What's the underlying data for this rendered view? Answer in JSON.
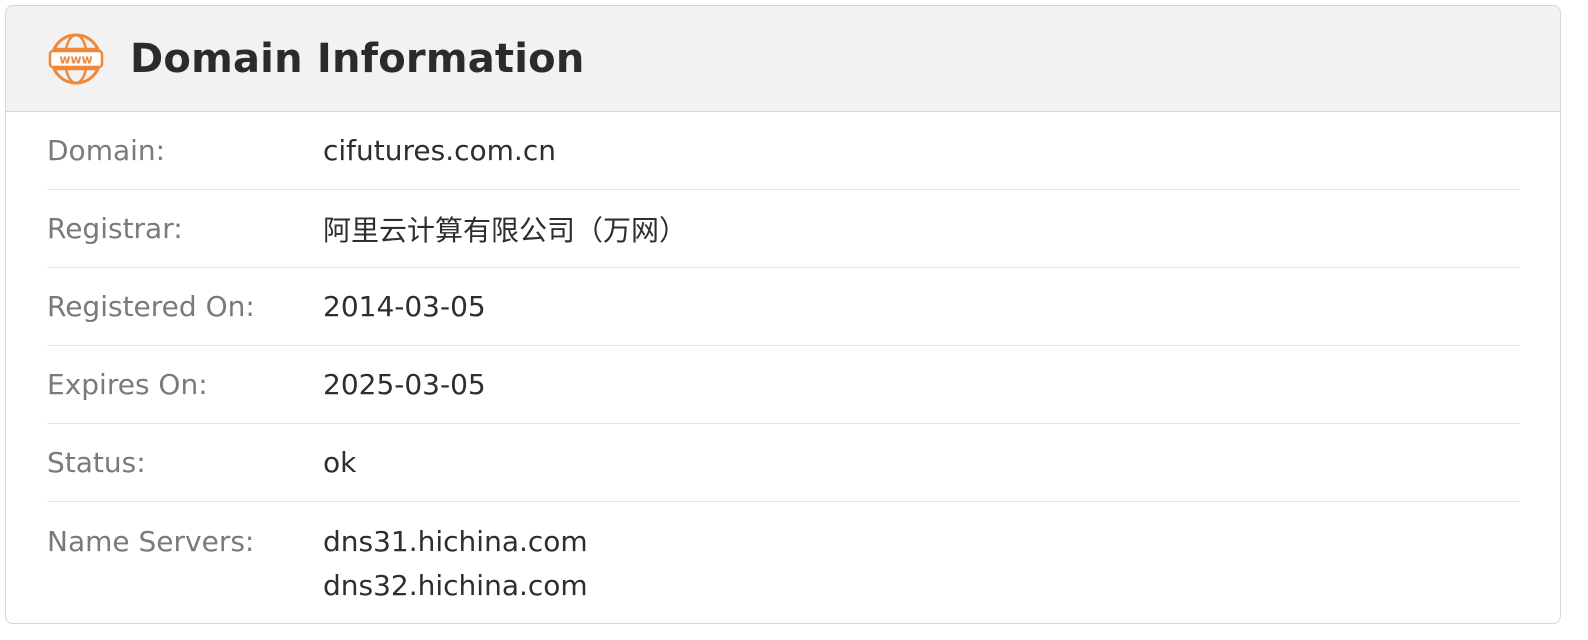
{
  "header": {
    "title": "Domain Information",
    "icon": "www-globe-icon",
    "icon_text": "www",
    "icon_color": "#f0883a"
  },
  "rows": [
    {
      "label": "Domain:",
      "value": "cifutures.com.cn"
    },
    {
      "label": "Registrar:",
      "value": "阿里云计算有限公司（万网）"
    },
    {
      "label": "Registered On:",
      "value": "2014-03-05"
    },
    {
      "label": "Expires On:",
      "value": "2025-03-05"
    },
    {
      "label": "Status:",
      "value": "ok"
    },
    {
      "label": "Name Servers:",
      "values": [
        "dns31.hichina.com",
        "dns32.hichina.com"
      ]
    }
  ]
}
